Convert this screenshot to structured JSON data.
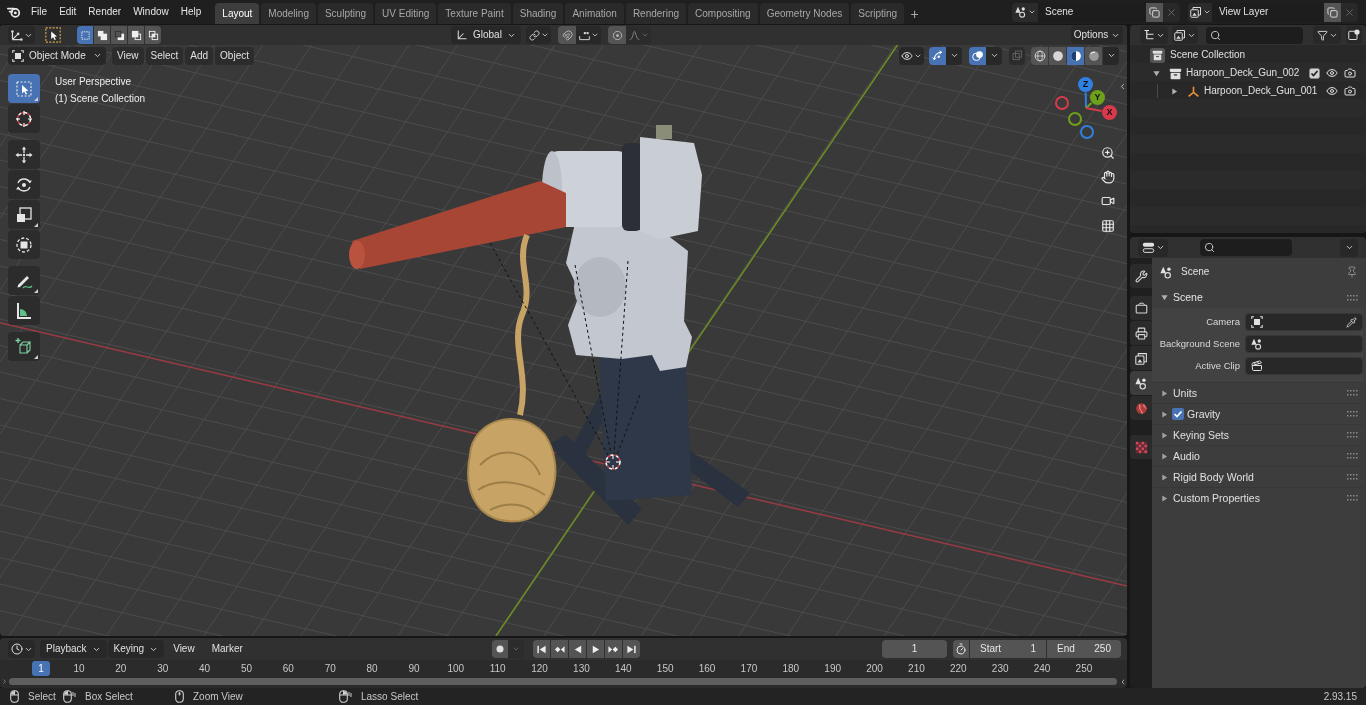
{
  "topbar": {
    "menus": [
      "File",
      "Edit",
      "Render",
      "Window",
      "Help"
    ],
    "workspaces": [
      {
        "label": "Layout",
        "selected": true
      },
      {
        "label": "Modeling",
        "selected": false
      },
      {
        "label": "Sculpting",
        "selected": false
      },
      {
        "label": "UV Editing",
        "selected": false
      },
      {
        "label": "Texture Paint",
        "selected": false
      },
      {
        "label": "Shading",
        "selected": false
      },
      {
        "label": "Animation",
        "selected": false
      },
      {
        "label": "Rendering",
        "selected": false
      },
      {
        "label": "Compositing",
        "selected": false
      },
      {
        "label": "Geometry Nodes",
        "selected": false
      },
      {
        "label": "Scripting",
        "selected": false
      }
    ],
    "add_tab": "+",
    "scene": "Scene",
    "view_layer": "View Layer"
  },
  "viewport": {
    "select_modes": [
      {
        "kind": "set",
        "selected": true
      },
      {
        "kind": "extend",
        "selected": false
      },
      {
        "kind": "subtract",
        "selected": false
      },
      {
        "kind": "invert",
        "selected": false
      },
      {
        "kind": "intersect",
        "selected": false
      }
    ],
    "orientation": "Global",
    "options": "Options",
    "mode": "Object Mode",
    "menus": [
      "View",
      "Select",
      "Add",
      "Object"
    ],
    "gizmos_on": true,
    "overlays_on": true,
    "xray_on": false,
    "shading": [
      {
        "kind": "wireframe",
        "selected": false
      },
      {
        "kind": "solid",
        "selected": false
      },
      {
        "kind": "material",
        "selected": true
      },
      {
        "kind": "rendered",
        "selected": false
      }
    ],
    "tools": [
      {
        "kind": "select_box",
        "selected": true
      },
      {
        "kind": "cursor",
        "selected": false
      },
      {
        "kind": "move",
        "selected": false
      },
      {
        "kind": "rotate",
        "selected": false
      },
      {
        "kind": "scale",
        "selected": false
      },
      {
        "kind": "transform",
        "selected": false
      },
      {
        "kind": "annotate",
        "selected": false
      },
      {
        "kind": "measure",
        "selected": false
      },
      {
        "kind": "add_cube",
        "selected": false
      }
    ],
    "info": [
      "User Perspective",
      "(1) Scene Collection"
    ],
    "axes": [
      {
        "label": "Z",
        "color": "#2f80df"
      },
      {
        "label": "Y",
        "color": "#6ea11b"
      },
      {
        "label": "X",
        "color": "#d83a4b"
      }
    ]
  },
  "timeline": {
    "menus": [
      {
        "label": "Playback",
        "kind": "dropdown"
      },
      {
        "label": "Keying",
        "kind": "dropdown"
      },
      {
        "label": "View",
        "kind": "menu"
      },
      {
        "label": "Marker",
        "kind": "menu"
      }
    ],
    "current_frame": "1",
    "start_label": "Start",
    "start": "1",
    "end_label": "End",
    "end": "250",
    "playhead": "1",
    "frames": [
      "10",
      "20",
      "30",
      "40",
      "50",
      "60",
      "70",
      "80",
      "90",
      "100",
      "110",
      "120",
      "130",
      "140",
      "150",
      "160",
      "170",
      "180",
      "190",
      "200",
      "210",
      "220",
      "230",
      "240",
      "250"
    ]
  },
  "outliner": {
    "root": "Scene Collection",
    "items": [
      {
        "label": "Harpoon_Deck_Gun_002",
        "kind": "collection",
        "expanded": true,
        "checked": true,
        "children": [
          {
            "label": "Harpoon_Deck_Gun_001",
            "kind": "empty",
            "expanded": false
          }
        ]
      }
    ]
  },
  "properties": {
    "tabs": [
      {
        "kind": "tool",
        "selected": false
      },
      {
        "kind": "render",
        "selected": false
      },
      {
        "kind": "output",
        "selected": false
      },
      {
        "kind": "view_layer",
        "selected": false
      },
      {
        "kind": "scene",
        "selected": true
      },
      {
        "kind": "world",
        "selected": false
      },
      {
        "kind": "texture",
        "selected": false
      }
    ],
    "context": "Scene",
    "panel": {
      "title": "Scene",
      "expanded": true,
      "fields": [
        {
          "label": "Camera",
          "kind": "object"
        },
        {
          "label": "Background Scene",
          "kind": "scene"
        },
        {
          "label": "Active Clip",
          "kind": "clip"
        }
      ]
    },
    "subpanels": [
      {
        "label": "Units",
        "expanded": false
      },
      {
        "label": "Gravity",
        "expanded": false,
        "checked": true
      },
      {
        "label": "Keying Sets",
        "expanded": false
      },
      {
        "label": "Audio",
        "expanded": false
      },
      {
        "label": "Rigid Body World",
        "expanded": false
      },
      {
        "label": "Custom Properties",
        "expanded": false
      }
    ]
  },
  "status_bar": {
    "hints": [
      {
        "kind": "left_click",
        "label": "Select"
      },
      {
        "kind": "left_drag",
        "label": "Box Select"
      },
      {
        "kind": "middle_click",
        "label": "Zoom View"
      },
      {
        "kind": "right_drag",
        "label": "Lasso Select"
      }
    ],
    "version": "2.93.15"
  }
}
